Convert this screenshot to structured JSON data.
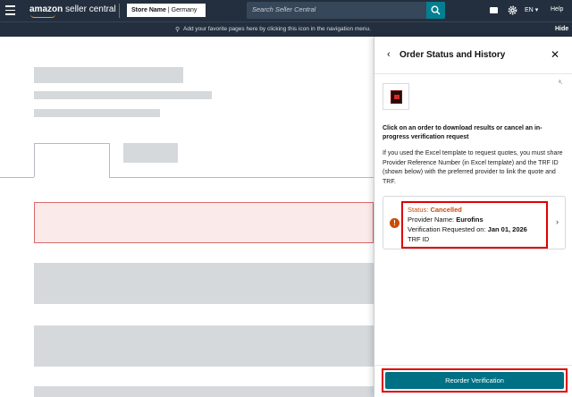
{
  "topbar": {
    "logo_brand": "amazon",
    "logo_product": "seller central",
    "store_name": "Store Name",
    "store_region": "Germany",
    "search_placeholder": "Search Seller Central",
    "language": "EN",
    "help": "Help"
  },
  "subbar": {
    "message": "Add your favorite pages here by clicking this icon in the navigation menu.",
    "hide": "Hide"
  },
  "panel": {
    "title": "Order Status and History",
    "instruction": "Click on an order to download results or cancel an in-progress verification request",
    "note": "If you used the Excel template to request quotes, you must share Provider Reference Number (in Excel template) and the TRF ID (shown below) with the preferred provider to link the quote and TRF.",
    "order": {
      "status_label": "Status:",
      "status_value": "Cancelled",
      "provider_label": "Provider Name:",
      "provider_value": "Eurofins",
      "requested_label": "Verification Requested on:",
      "requested_value": "Jan 01, 2026",
      "trf_label": "TRF ID"
    },
    "reorder_label": "Reorder Verification"
  },
  "colors": {
    "topbar_bg": "#232f3e",
    "accent_teal": "#007185",
    "status_orange": "#cc4a06",
    "highlight_red": "#e00000"
  }
}
